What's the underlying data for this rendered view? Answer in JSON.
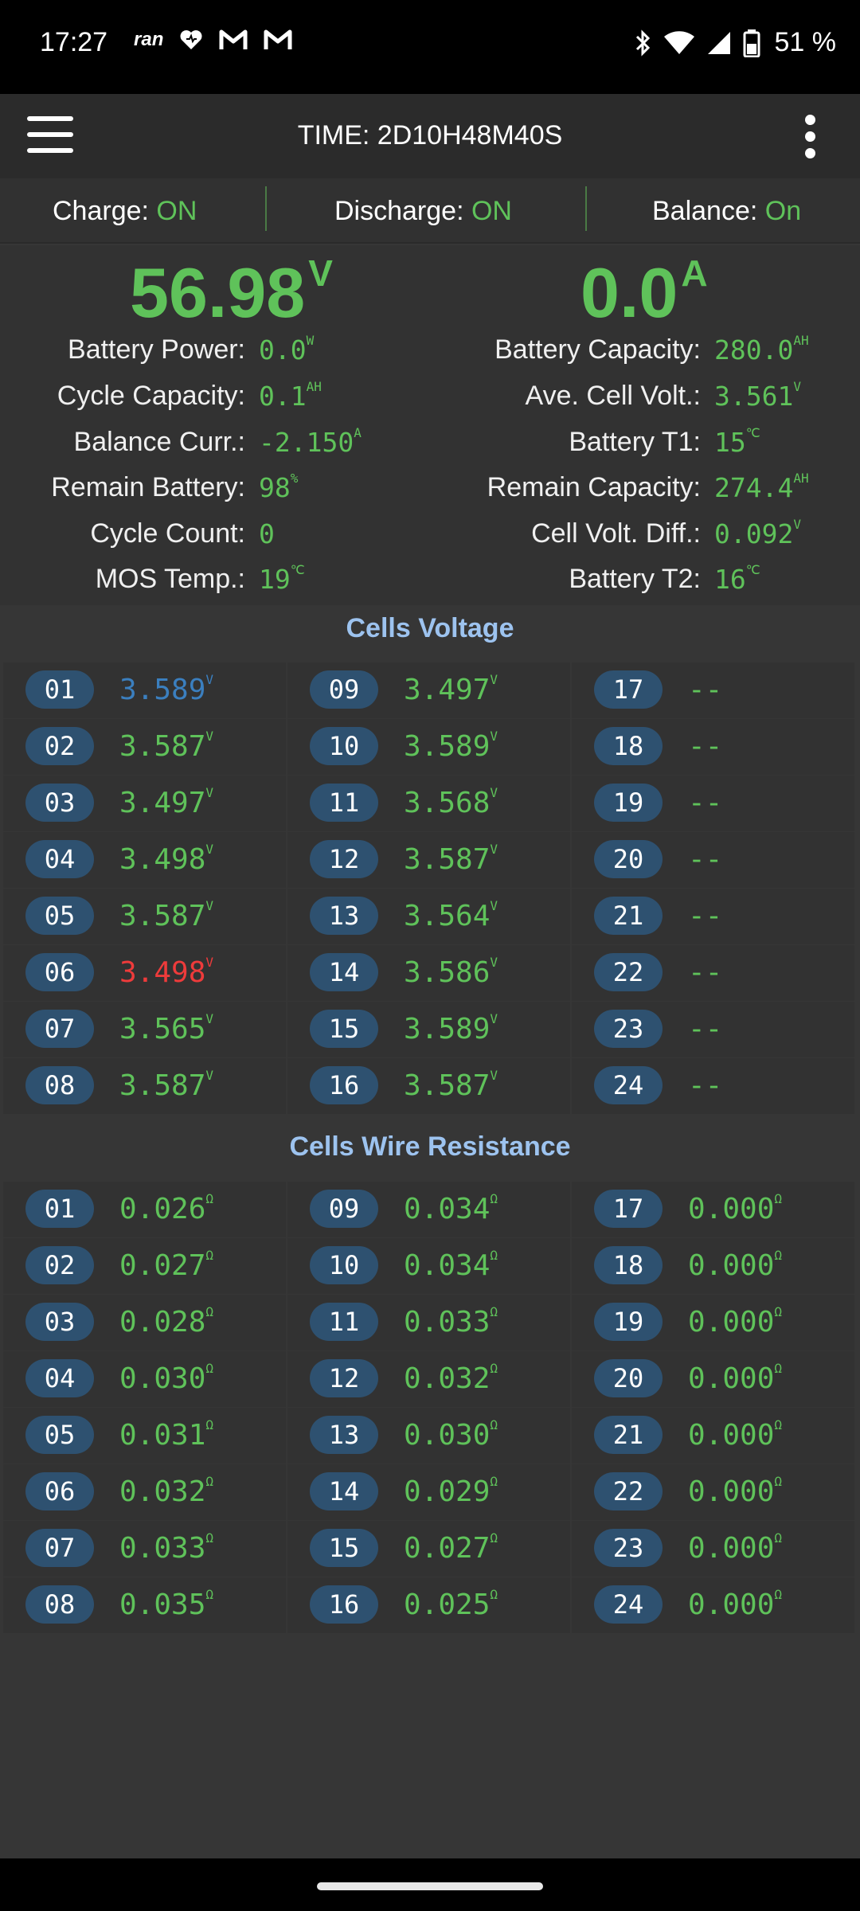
{
  "status_bar": {
    "time": "17:27",
    "notification_icons": [
      "ran-app-icon",
      "heart-icon",
      "gmail-icon",
      "gmail-icon"
    ],
    "system_icons": [
      "bluetooth-icon",
      "wifi-icon",
      "cellular-signal-icon",
      "battery-icon"
    ],
    "battery_text": "51 %"
  },
  "appbar": {
    "title": "TIME: 2D10H48M40S"
  },
  "switches": [
    {
      "label": "Charge:",
      "value": "ON"
    },
    {
      "label": "Discharge:",
      "value": "ON"
    },
    {
      "label": "Balance:",
      "value": "On"
    }
  ],
  "summary": {
    "voltage": {
      "value": "56.98",
      "unit": "V"
    },
    "current": {
      "value": "0.0",
      "unit": "A"
    },
    "left": [
      {
        "label": "Battery Power:",
        "value": "0.0",
        "unit": "W"
      },
      {
        "label": "Cycle Capacity:",
        "value": "0.1",
        "unit": "AH"
      },
      {
        "label": "Balance Curr.:",
        "value": "-2.150",
        "unit": "A"
      },
      {
        "label": "Remain Battery:",
        "value": "98",
        "unit": "%"
      },
      {
        "label": "Cycle Count:",
        "value": "0",
        "unit": ""
      },
      {
        "label": "MOS Temp.:",
        "value": "19",
        "unit": "℃"
      }
    ],
    "right": [
      {
        "label": "Battery Capacity:",
        "value": "280.0",
        "unit": "AH"
      },
      {
        "label": "Ave. Cell Volt.:",
        "value": "3.561",
        "unit": "V"
      },
      {
        "label": "Battery T1:",
        "value": "15",
        "unit": "℃"
      },
      {
        "label": "Remain Capacity:",
        "value": "274.4",
        "unit": "AH"
      },
      {
        "label": "Cell Volt. Diff.:",
        "value": "0.092",
        "unit": "V"
      },
      {
        "label": "Battery T2:",
        "value": "16",
        "unit": "℃"
      }
    ]
  },
  "cells_voltage": {
    "title": "Cells Voltage",
    "cells": [
      {
        "id": "01",
        "value": "3.589",
        "unit": "V",
        "state": "max"
      },
      {
        "id": "02",
        "value": "3.587",
        "unit": "V"
      },
      {
        "id": "03",
        "value": "3.497",
        "unit": "V"
      },
      {
        "id": "04",
        "value": "3.498",
        "unit": "V"
      },
      {
        "id": "05",
        "value": "3.587",
        "unit": "V"
      },
      {
        "id": "06",
        "value": "3.498",
        "unit": "V",
        "state": "min"
      },
      {
        "id": "07",
        "value": "3.565",
        "unit": "V"
      },
      {
        "id": "08",
        "value": "3.587",
        "unit": "V"
      },
      {
        "id": "09",
        "value": "3.497",
        "unit": "V"
      },
      {
        "id": "10",
        "value": "3.589",
        "unit": "V"
      },
      {
        "id": "11",
        "value": "3.568",
        "unit": "V"
      },
      {
        "id": "12",
        "value": "3.587",
        "unit": "V"
      },
      {
        "id": "13",
        "value": "3.564",
        "unit": "V"
      },
      {
        "id": "14",
        "value": "3.586",
        "unit": "V"
      },
      {
        "id": "15",
        "value": "3.589",
        "unit": "V"
      },
      {
        "id": "16",
        "value": "3.587",
        "unit": "V"
      },
      {
        "id": "17",
        "value": "--",
        "unit": ""
      },
      {
        "id": "18",
        "value": "--",
        "unit": ""
      },
      {
        "id": "19",
        "value": "--",
        "unit": ""
      },
      {
        "id": "20",
        "value": "--",
        "unit": ""
      },
      {
        "id": "21",
        "value": "--",
        "unit": ""
      },
      {
        "id": "22",
        "value": "--",
        "unit": ""
      },
      {
        "id": "23",
        "value": "--",
        "unit": ""
      },
      {
        "id": "24",
        "value": "--",
        "unit": ""
      }
    ]
  },
  "cells_resistance": {
    "title": "Cells Wire Resistance",
    "cells": [
      {
        "id": "01",
        "value": "0.026",
        "unit": "Ω"
      },
      {
        "id": "02",
        "value": "0.027",
        "unit": "Ω"
      },
      {
        "id": "03",
        "value": "0.028",
        "unit": "Ω"
      },
      {
        "id": "04",
        "value": "0.030",
        "unit": "Ω"
      },
      {
        "id": "05",
        "value": "0.031",
        "unit": "Ω"
      },
      {
        "id": "06",
        "value": "0.032",
        "unit": "Ω"
      },
      {
        "id": "07",
        "value": "0.033",
        "unit": "Ω"
      },
      {
        "id": "08",
        "value": "0.035",
        "unit": "Ω"
      },
      {
        "id": "09",
        "value": "0.034",
        "unit": "Ω"
      },
      {
        "id": "10",
        "value": "0.034",
        "unit": "Ω"
      },
      {
        "id": "11",
        "value": "0.033",
        "unit": "Ω"
      },
      {
        "id": "12",
        "value": "0.032",
        "unit": "Ω"
      },
      {
        "id": "13",
        "value": "0.030",
        "unit": "Ω"
      },
      {
        "id": "14",
        "value": "0.029",
        "unit": "Ω"
      },
      {
        "id": "15",
        "value": "0.027",
        "unit": "Ω"
      },
      {
        "id": "16",
        "value": "0.025",
        "unit": "Ω"
      },
      {
        "id": "17",
        "value": "0.000",
        "unit": "Ω"
      },
      {
        "id": "18",
        "value": "0.000",
        "unit": "Ω"
      },
      {
        "id": "19",
        "value": "0.000",
        "unit": "Ω"
      },
      {
        "id": "20",
        "value": "0.000",
        "unit": "Ω"
      },
      {
        "id": "21",
        "value": "0.000",
        "unit": "Ω"
      },
      {
        "id": "22",
        "value": "0.000",
        "unit": "Ω"
      },
      {
        "id": "23",
        "value": "0.000",
        "unit": "Ω"
      },
      {
        "id": "24",
        "value": "0.000",
        "unit": "Ω"
      }
    ]
  },
  "colors": {
    "value_green": "#5fc25a",
    "max_cell_blue": "#3b7fbf",
    "min_cell_red": "#ee3b3b",
    "badge_bg": "#2e5170",
    "section_title": "#9dc3ef"
  }
}
